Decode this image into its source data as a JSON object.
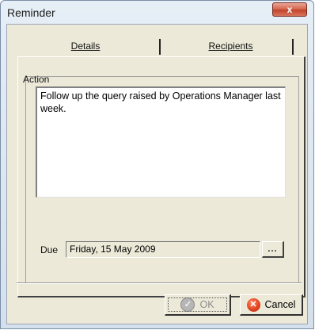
{
  "window": {
    "title": "Reminder",
    "close_glyph": "x"
  },
  "tabs": [
    {
      "label": "Details",
      "selected": true
    },
    {
      "label": "Recipients",
      "selected": false
    }
  ],
  "details": {
    "action_label": "Action",
    "action_text": "Follow up the query raised by Operations Manager last week.",
    "due_label": "Due",
    "due_value": "Friday, 15 May 2009",
    "ellipsis_label": "..."
  },
  "buttons": {
    "ok_label": "OK",
    "ok_enabled": false,
    "cancel_label": "Cancel"
  },
  "icons": {
    "ok": "check-icon",
    "cancel": "cancel-x-icon",
    "close": "close-icon"
  },
  "colors": {
    "cancel_icon": "#e04420",
    "close_button": "#c0432b"
  }
}
